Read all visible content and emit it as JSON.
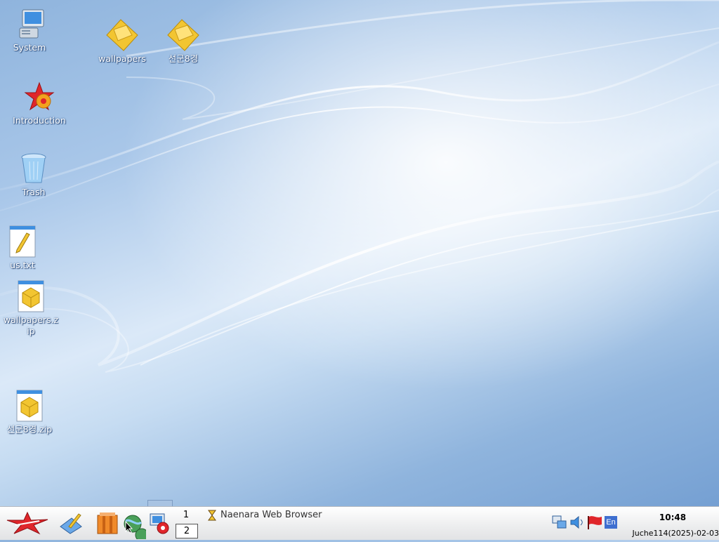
{
  "desktop": {
    "icons": [
      {
        "label": "System",
        "icon": "computer-icon"
      },
      {
        "label": "wallpapers",
        "icon": "folder-icon"
      },
      {
        "label": "선군8경",
        "icon": "folder-icon"
      },
      {
        "label": "Introduction",
        "icon": "introduction-star-icon"
      },
      {
        "label": "Trash",
        "icon": "trash-icon"
      },
      {
        "label": "us.txt",
        "icon": "text-file-icon"
      },
      {
        "label": "wallpapers.zip",
        "icon": "zip-file-icon"
      },
      {
        "label": "선군8경.zip",
        "icon": "zip-file-icon"
      }
    ]
  },
  "taskbar": {
    "start_icon": "red-star-menu-icon",
    "launchers": [
      "editor-icon",
      "file-manager-icon",
      "web-browser-icon",
      "control-panel-icon"
    ],
    "pager": [
      "1",
      "2"
    ],
    "active_workspace": "2",
    "task": {
      "title": "Naenara Web Browser",
      "icon": "hourglass-icon"
    },
    "tray": [
      "network-icon",
      "volume-icon",
      "flag-icon",
      "input-method-icon"
    ],
    "input_method": "En",
    "clock": "10:48",
    "date": "Juche114(2025)-02-03"
  },
  "colors": {
    "desktop": "#a9c7e9",
    "taskbar": "#ecedee",
    "star": "#e0262b"
  }
}
